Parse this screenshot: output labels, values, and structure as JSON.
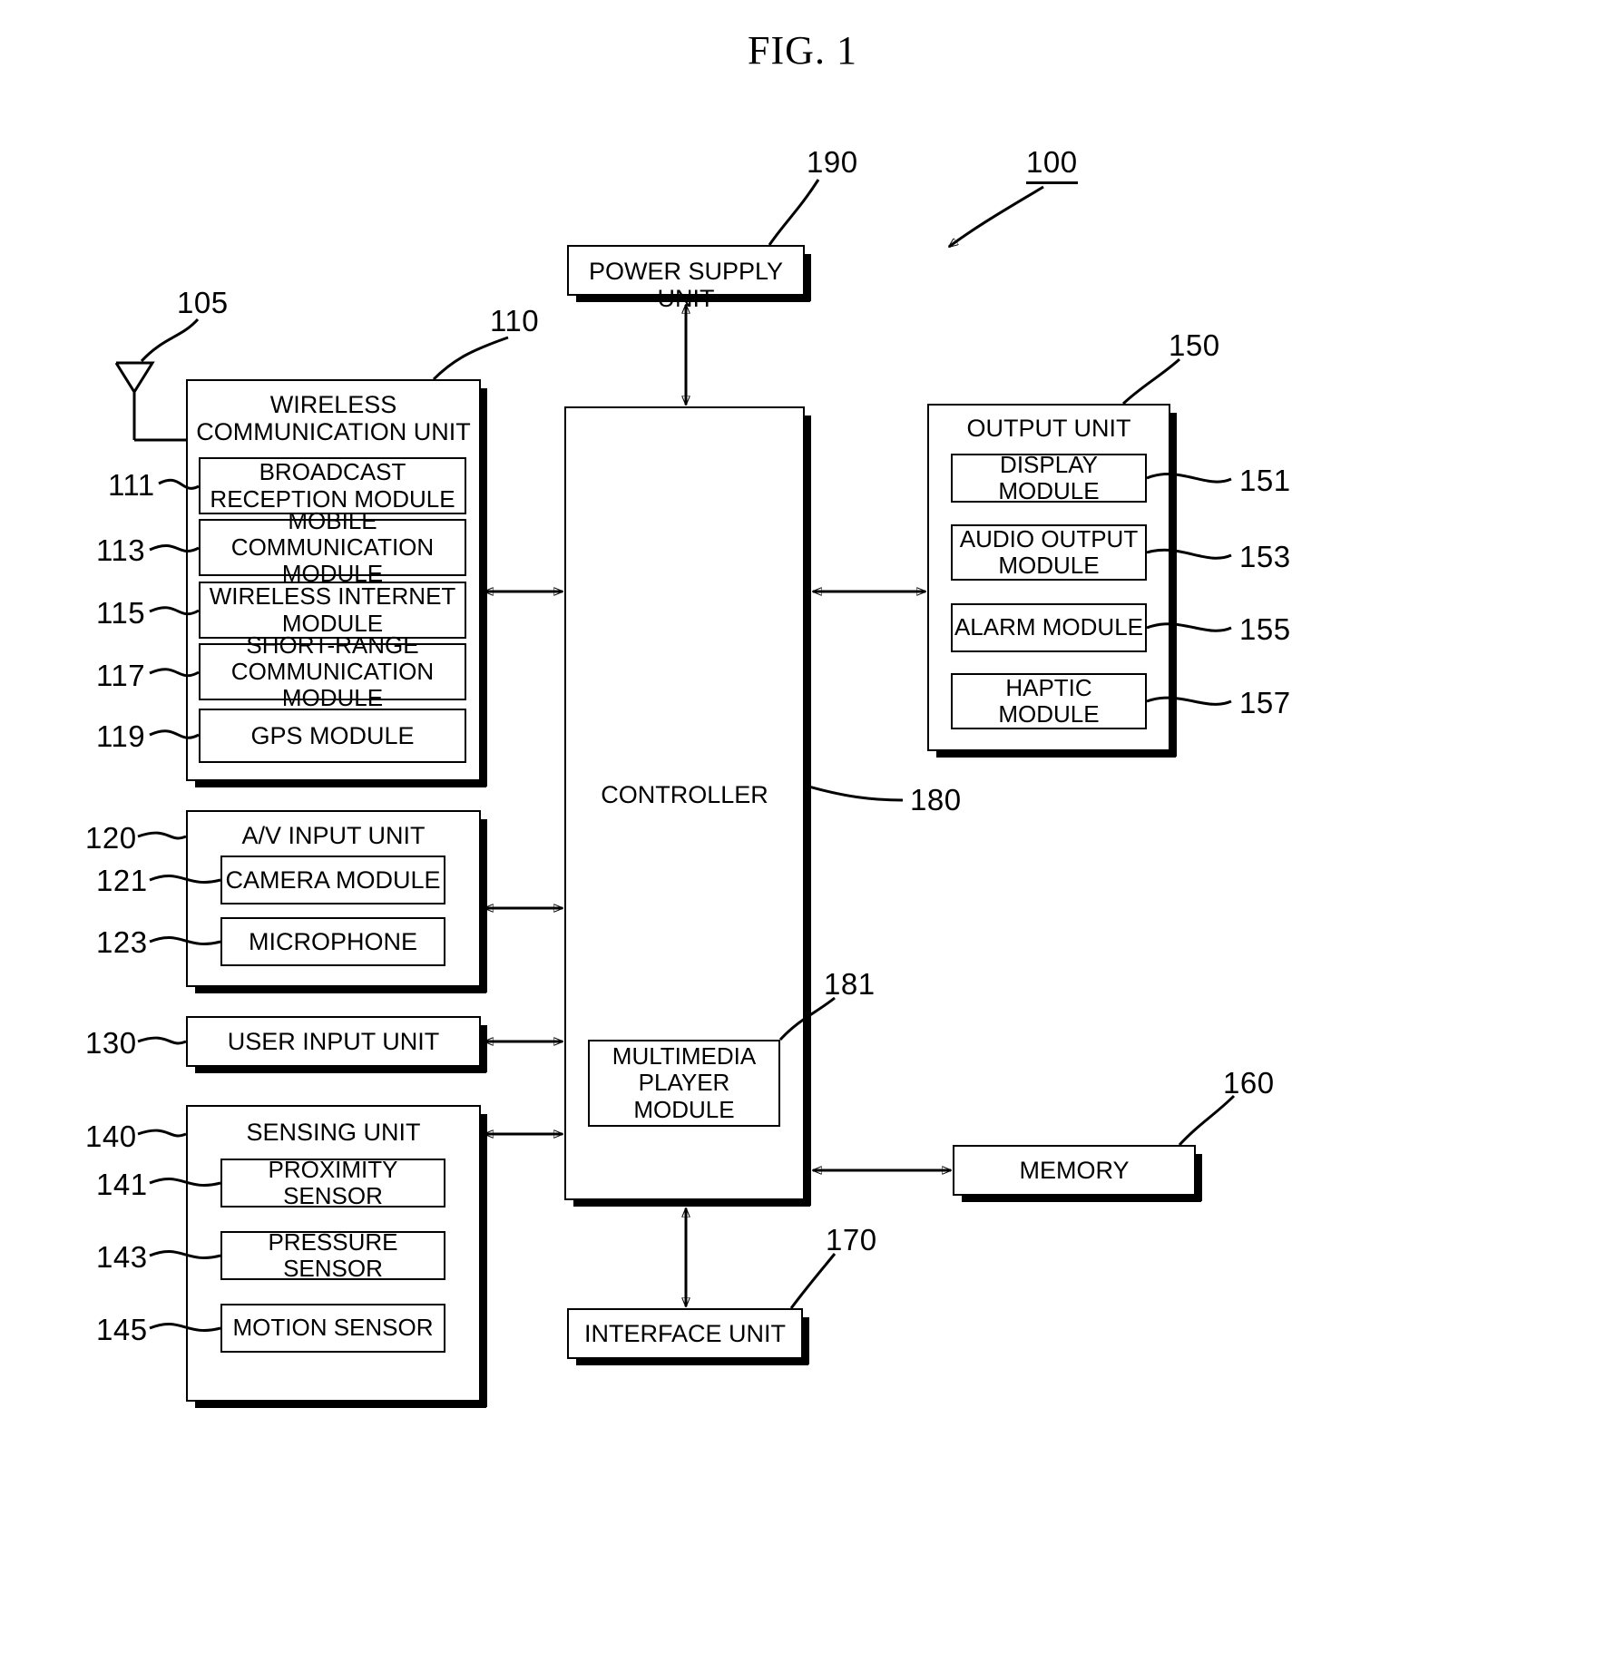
{
  "figure": {
    "title": "FIG. 1",
    "system_ref": "100"
  },
  "blocks": {
    "power_supply": {
      "label": "POWER SUPPLY UNIT",
      "ref": "190"
    },
    "wireless_unit": {
      "label": "WIRELESS\nCOMMUNICATION UNIT",
      "ref": "110",
      "antenna_ref": "105",
      "modules": [
        {
          "label": "BROADCAST\nRECEPTION MODULE",
          "ref": "111"
        },
        {
          "label": "MOBILE COMMUNICATION\nMODULE",
          "ref": "113"
        },
        {
          "label": "WIRELESS INTERNET\nMODULE",
          "ref": "115"
        },
        {
          "label": "SHORT-RANGE\nCOMMUNICATION MODULE",
          "ref": "117"
        },
        {
          "label": "GPS MODULE",
          "ref": "119"
        }
      ]
    },
    "av_input_unit": {
      "label": "A/V INPUT UNIT",
      "ref": "120",
      "modules": [
        {
          "label": "CAMERA MODULE",
          "ref": "121"
        },
        {
          "label": "MICROPHONE",
          "ref": "123"
        }
      ]
    },
    "user_input_unit": {
      "label": "USER INPUT UNIT",
      "ref": "130"
    },
    "sensing_unit": {
      "label": "SENSING UNIT",
      "ref": "140",
      "modules": [
        {
          "label": "PROXIMITY SENSOR",
          "ref": "141"
        },
        {
          "label": "PRESSURE SENSOR",
          "ref": "143"
        },
        {
          "label": "MOTION SENSOR",
          "ref": "145"
        }
      ]
    },
    "controller": {
      "label": "CONTROLLER",
      "ref": "180",
      "modules": [
        {
          "label": "MULTIMEDIA\nPLAYER MODULE",
          "ref": "181"
        }
      ]
    },
    "output_unit": {
      "label": "OUTPUT UNIT",
      "ref": "150",
      "modules": [
        {
          "label": "DISPLAY MODULE",
          "ref": "151"
        },
        {
          "label": "AUDIO OUTPUT\nMODULE",
          "ref": "153"
        },
        {
          "label": "ALARM MODULE",
          "ref": "155"
        },
        {
          "label": "HAPTIC\nMODULE",
          "ref": "157"
        }
      ]
    },
    "memory": {
      "label": "MEMORY",
      "ref": "160"
    },
    "interface_unit": {
      "label": "INTERFACE UNIT",
      "ref": "170"
    }
  }
}
